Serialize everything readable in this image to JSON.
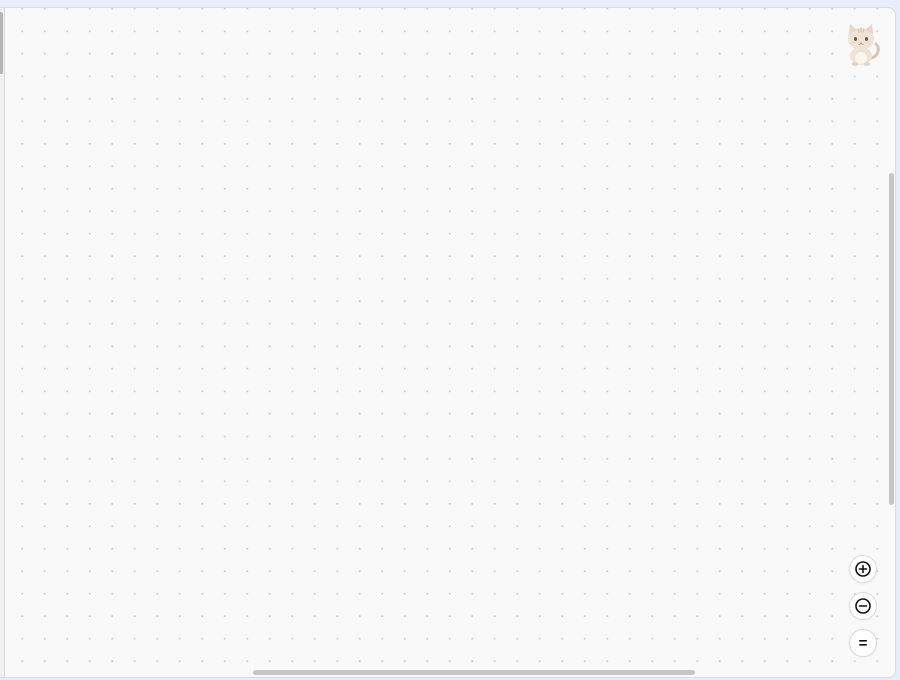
{
  "canvas": {
    "background_color": "#f9f9f9",
    "dot_color": "#d2d2d2"
  },
  "avatar": {
    "icon": "cat-mascot-icon"
  },
  "zoom_controls": {
    "zoom_in": {
      "icon": "zoom-in-icon"
    },
    "zoom_out": {
      "icon": "zoom-out-icon"
    },
    "fit": {
      "icon": "fit-view-icon",
      "label": "="
    }
  }
}
